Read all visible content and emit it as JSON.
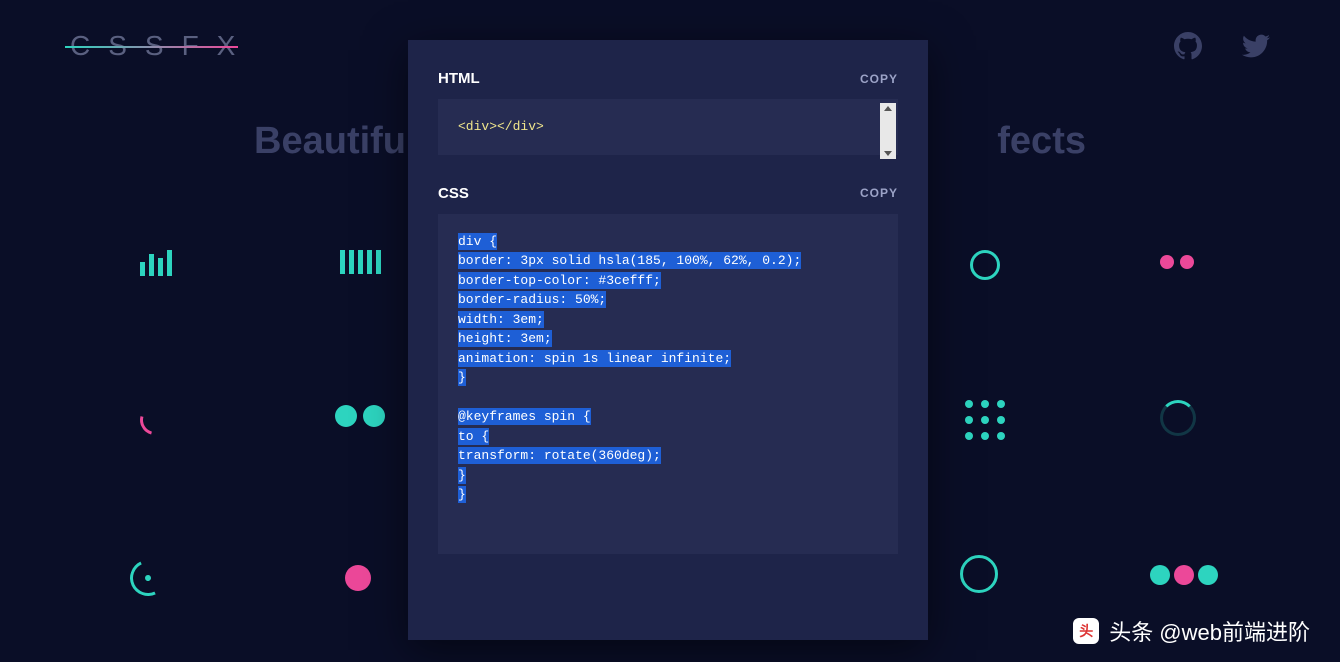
{
  "header": {
    "logo": "CSSFX"
  },
  "hero": {
    "text_left": "Beautifull",
    "text_right": "fects"
  },
  "modal": {
    "html_section": {
      "title": "HTML",
      "copy_label": "COPY",
      "code": "<div></div>"
    },
    "css_section": {
      "title": "CSS",
      "copy_label": "COPY",
      "code_lines": [
        "div {",
        "  border: 3px solid hsla(185, 100%, 62%, 0.2);",
        "  border-top-color: #3cefff;",
        "  border-radius: 50%;",
        "  width: 3em;",
        "  height: 3em;",
        "  animation: spin 1s linear infinite;",
        "}",
        "",
        "@keyframes spin {",
        "  to {",
        "    transform: rotate(360deg);",
        "  }",
        "}"
      ]
    }
  },
  "watermark": {
    "text": "头条 @web前端进阶"
  }
}
